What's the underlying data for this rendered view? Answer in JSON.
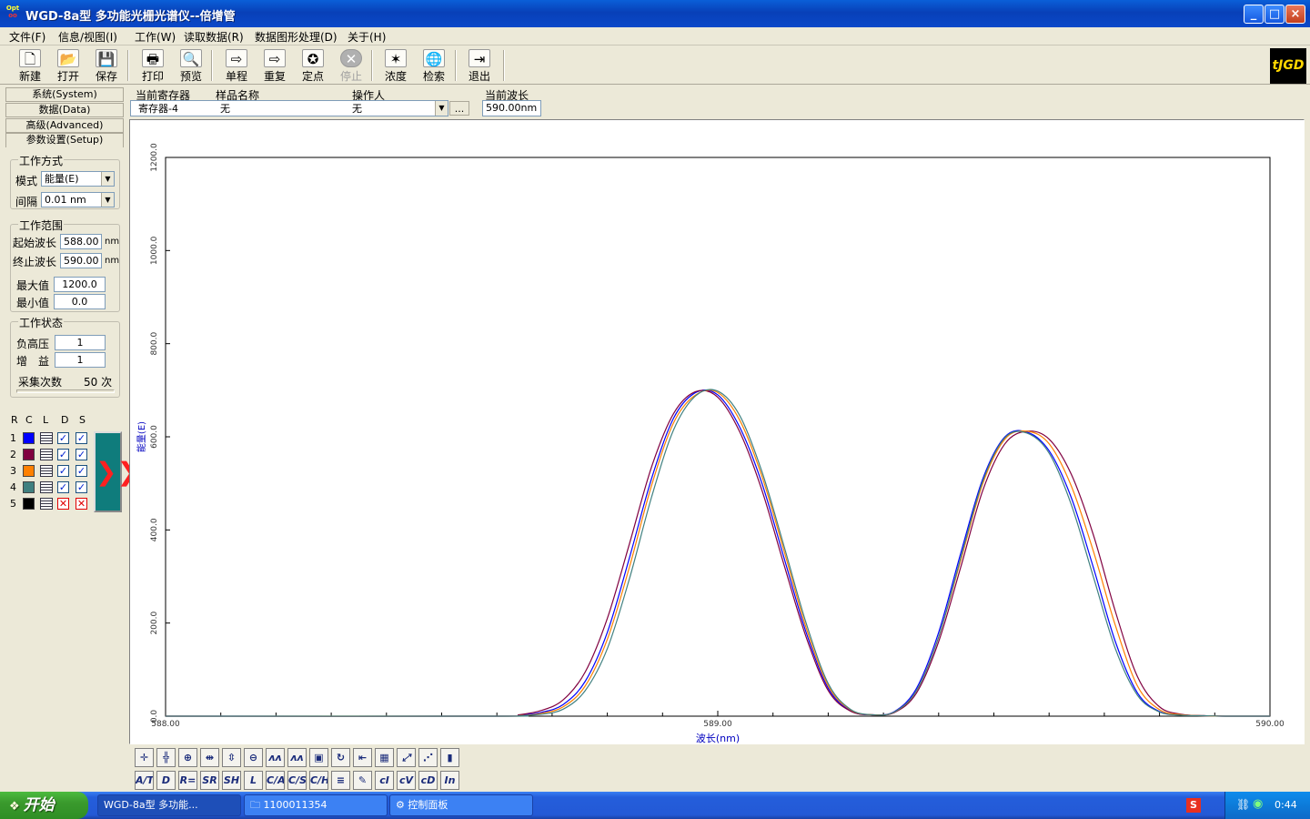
{
  "window": {
    "title": "WGD-8a型 多功能光栅光谱仪--倍增管",
    "app_icon_top": "Opt",
    "app_icon_bottom": "oo",
    "controls": [
      "_",
      "□",
      "×"
    ]
  },
  "menu": [
    "文件(F)",
    "信息/视图(I)",
    "工作(W)",
    "读取数据(R)",
    "数据图形处理(D)",
    "关于(H)"
  ],
  "toolbar": {
    "buttons": [
      {
        "label": "新建",
        "icon": "new-file-icon",
        "glyph": "🗋"
      },
      {
        "label": "打开",
        "icon": "open-folder-icon",
        "glyph": "📂"
      },
      {
        "label": "保存",
        "icon": "save-disk-icon",
        "glyph": "💾"
      },
      {
        "label": "打印",
        "icon": "printer-icon",
        "glyph": "🖶"
      },
      {
        "label": "预览",
        "icon": "preview-icon",
        "glyph": "🔍"
      },
      {
        "label": "单程",
        "icon": "arrow-right-icon",
        "glyph": "⇨"
      },
      {
        "label": "重复",
        "icon": "repeat-arrow-icon",
        "glyph": "⇨"
      },
      {
        "label": "定点",
        "icon": "satellite-icon",
        "glyph": "✪"
      },
      {
        "label": "停止",
        "icon": "stop-icon",
        "glyph": "✕",
        "disabled": true
      },
      {
        "label": "浓度",
        "icon": "concentration-icon",
        "glyph": "✶"
      },
      {
        "label": "检索",
        "icon": "globe-search-icon",
        "glyph": "🌐"
      },
      {
        "label": "退出",
        "icon": "exit-door-icon",
        "glyph": "⇥"
      }
    ],
    "logo_text": "tJGD"
  },
  "nav_tabs": [
    "系统(System)",
    "数据(Data)",
    "高级(Advanced)",
    "参数设置(Setup)"
  ],
  "setup": {
    "work_mode": {
      "title": "工作方式",
      "mode_label": "模式",
      "mode_value": "能量(E)",
      "interval_label": "间隔",
      "interval_value": "0.01 nm"
    },
    "work_range": {
      "title": "工作范围",
      "start_label": "起始波长",
      "start_value": "588.00",
      "end_label": "终止波长",
      "end_value": "590.00",
      "unit": "nm",
      "max_label": "最大值",
      "max_value": "1200.0",
      "min_label": "最小值",
      "min_value": "0.0"
    },
    "work_status": {
      "title": "工作状态",
      "hv_label": "负高压",
      "hv_value": "1",
      "gain_label": "增　益",
      "gain_value": "1",
      "samples_label": "采集次数",
      "samples_value": "50",
      "samples_unit": "次"
    }
  },
  "curve_table": {
    "headers": [
      "R",
      "C",
      "L",
      "D",
      "S"
    ],
    "rows": [
      {
        "num": "1",
        "color": "#0000ff",
        "d": "✓",
        "s": "✓"
      },
      {
        "num": "2",
        "color": "#800040",
        "d": "✓",
        "s": "✓"
      },
      {
        "num": "3",
        "color": "#ff8000",
        "d": "✓",
        "s": "✓"
      },
      {
        "num": "4",
        "color": "#408080",
        "d": "✓",
        "s": "✓"
      },
      {
        "num": "5",
        "color": "#000000",
        "d": "✕",
        "s": "✕"
      }
    ],
    "arrow_glyph": "❯❯"
  },
  "info": {
    "register_label": "当前寄存器",
    "register_value": "寄存器-4",
    "sample_label": "样品名称",
    "sample_value": "无",
    "operator_label": "操作人",
    "operator_value": "无",
    "browse": "...",
    "wavelength_label": "当前波长",
    "wavelength_value": "590.00nm"
  },
  "chart_data": {
    "type": "line",
    "xlabel": "波长(nm)",
    "ylabel": "能量(E)",
    "xlim": [
      588.0,
      590.0
    ],
    "ylim": [
      0,
      1200
    ],
    "x_ticks": [
      "588.00",
      "589.00",
      "590.00"
    ],
    "y_ticks": [
      "0.0",
      "200.0",
      "400.0",
      "600.0",
      "800.0",
      "1000.0",
      "1200.0"
    ],
    "x": [
      588.0,
      588.6,
      588.64,
      588.68,
      588.72,
      588.76,
      588.8,
      588.84,
      588.88,
      588.92,
      588.96,
      589.0,
      589.04,
      589.08,
      589.12,
      589.16,
      589.2,
      589.24,
      589.28,
      589.32,
      589.36,
      589.4,
      589.44,
      589.48,
      589.52,
      589.56,
      589.6,
      589.64,
      589.68,
      589.72,
      589.76,
      589.8,
      589.84,
      589.88,
      589.92,
      589.96,
      590.0
    ],
    "series": [
      {
        "color": "#0000ff",
        "values": [
          0,
          0,
          2,
          8,
          25,
          75,
          180,
          340,
          510,
          640,
          695,
          690,
          620,
          500,
          340,
          180,
          60,
          12,
          3,
          10,
          60,
          180,
          350,
          510,
          600,
          610,
          570,
          470,
          320,
          160,
          50,
          10,
          3,
          1,
          0,
          0,
          0
        ]
      },
      {
        "color": "#800040",
        "values": [
          0,
          0,
          3,
          12,
          35,
          95,
          210,
          370,
          535,
          650,
          697,
          685,
          610,
          485,
          325,
          170,
          55,
          11,
          3,
          8,
          50,
          160,
          320,
          485,
          585,
          612,
          595,
          520,
          390,
          225,
          85,
          20,
          4,
          1,
          0,
          0,
          0
        ]
      },
      {
        "color": "#ff8000",
        "values": [
          0,
          0,
          1,
          6,
          20,
          65,
          165,
          320,
          495,
          630,
          690,
          695,
          635,
          515,
          355,
          190,
          65,
          14,
          3,
          9,
          55,
          170,
          335,
          500,
          595,
          612,
          585,
          495,
          355,
          195,
          65,
          14,
          3,
          1,
          0,
          0,
          0
        ]
      },
      {
        "color": "#408080",
        "values": [
          0,
          0,
          1,
          4,
          15,
          55,
          145,
          295,
          470,
          615,
          688,
          698,
          645,
          525,
          365,
          200,
          70,
          15,
          3,
          9,
          55,
          170,
          340,
          505,
          598,
          608,
          565,
          455,
          300,
          145,
          45,
          9,
          2,
          1,
          0,
          0,
          0
        ]
      }
    ]
  },
  "bottom_tools": {
    "row1": [
      "crosshair-icon",
      "split-cursor-icon",
      "zoom-in-icon",
      "h-expand-icon",
      "v-expand-icon",
      "zoom-out-icon",
      "peaks-icon",
      "peak-mark-icon",
      "spectrum-view-icon",
      "refresh-icon",
      "fit-width-icon",
      "grid-icon",
      "axis-scale-icon",
      "axis-scatter-icon",
      "bar-meter-icon"
    ],
    "row1_glyphs": [
      "✛",
      "╬",
      "⊕",
      "⇹",
      "⇳",
      "⊖",
      "ʌʌ",
      "ʌʌ",
      "▣",
      "↻",
      "⇤",
      "▦",
      "⤢",
      "⋰",
      "▮"
    ],
    "row2": [
      "A/T",
      "D",
      "R=",
      "SR",
      "SH",
      "L",
      "C/A",
      "C/S",
      "C/H",
      "≡",
      "✎",
      "cI",
      "cV",
      "cD",
      "In"
    ]
  },
  "taskbar": {
    "start": "开始",
    "items": [
      "WGD-8a型 多功能...",
      "1100011354",
      "控制面板"
    ],
    "ime": "S",
    "clock": "0:44"
  }
}
